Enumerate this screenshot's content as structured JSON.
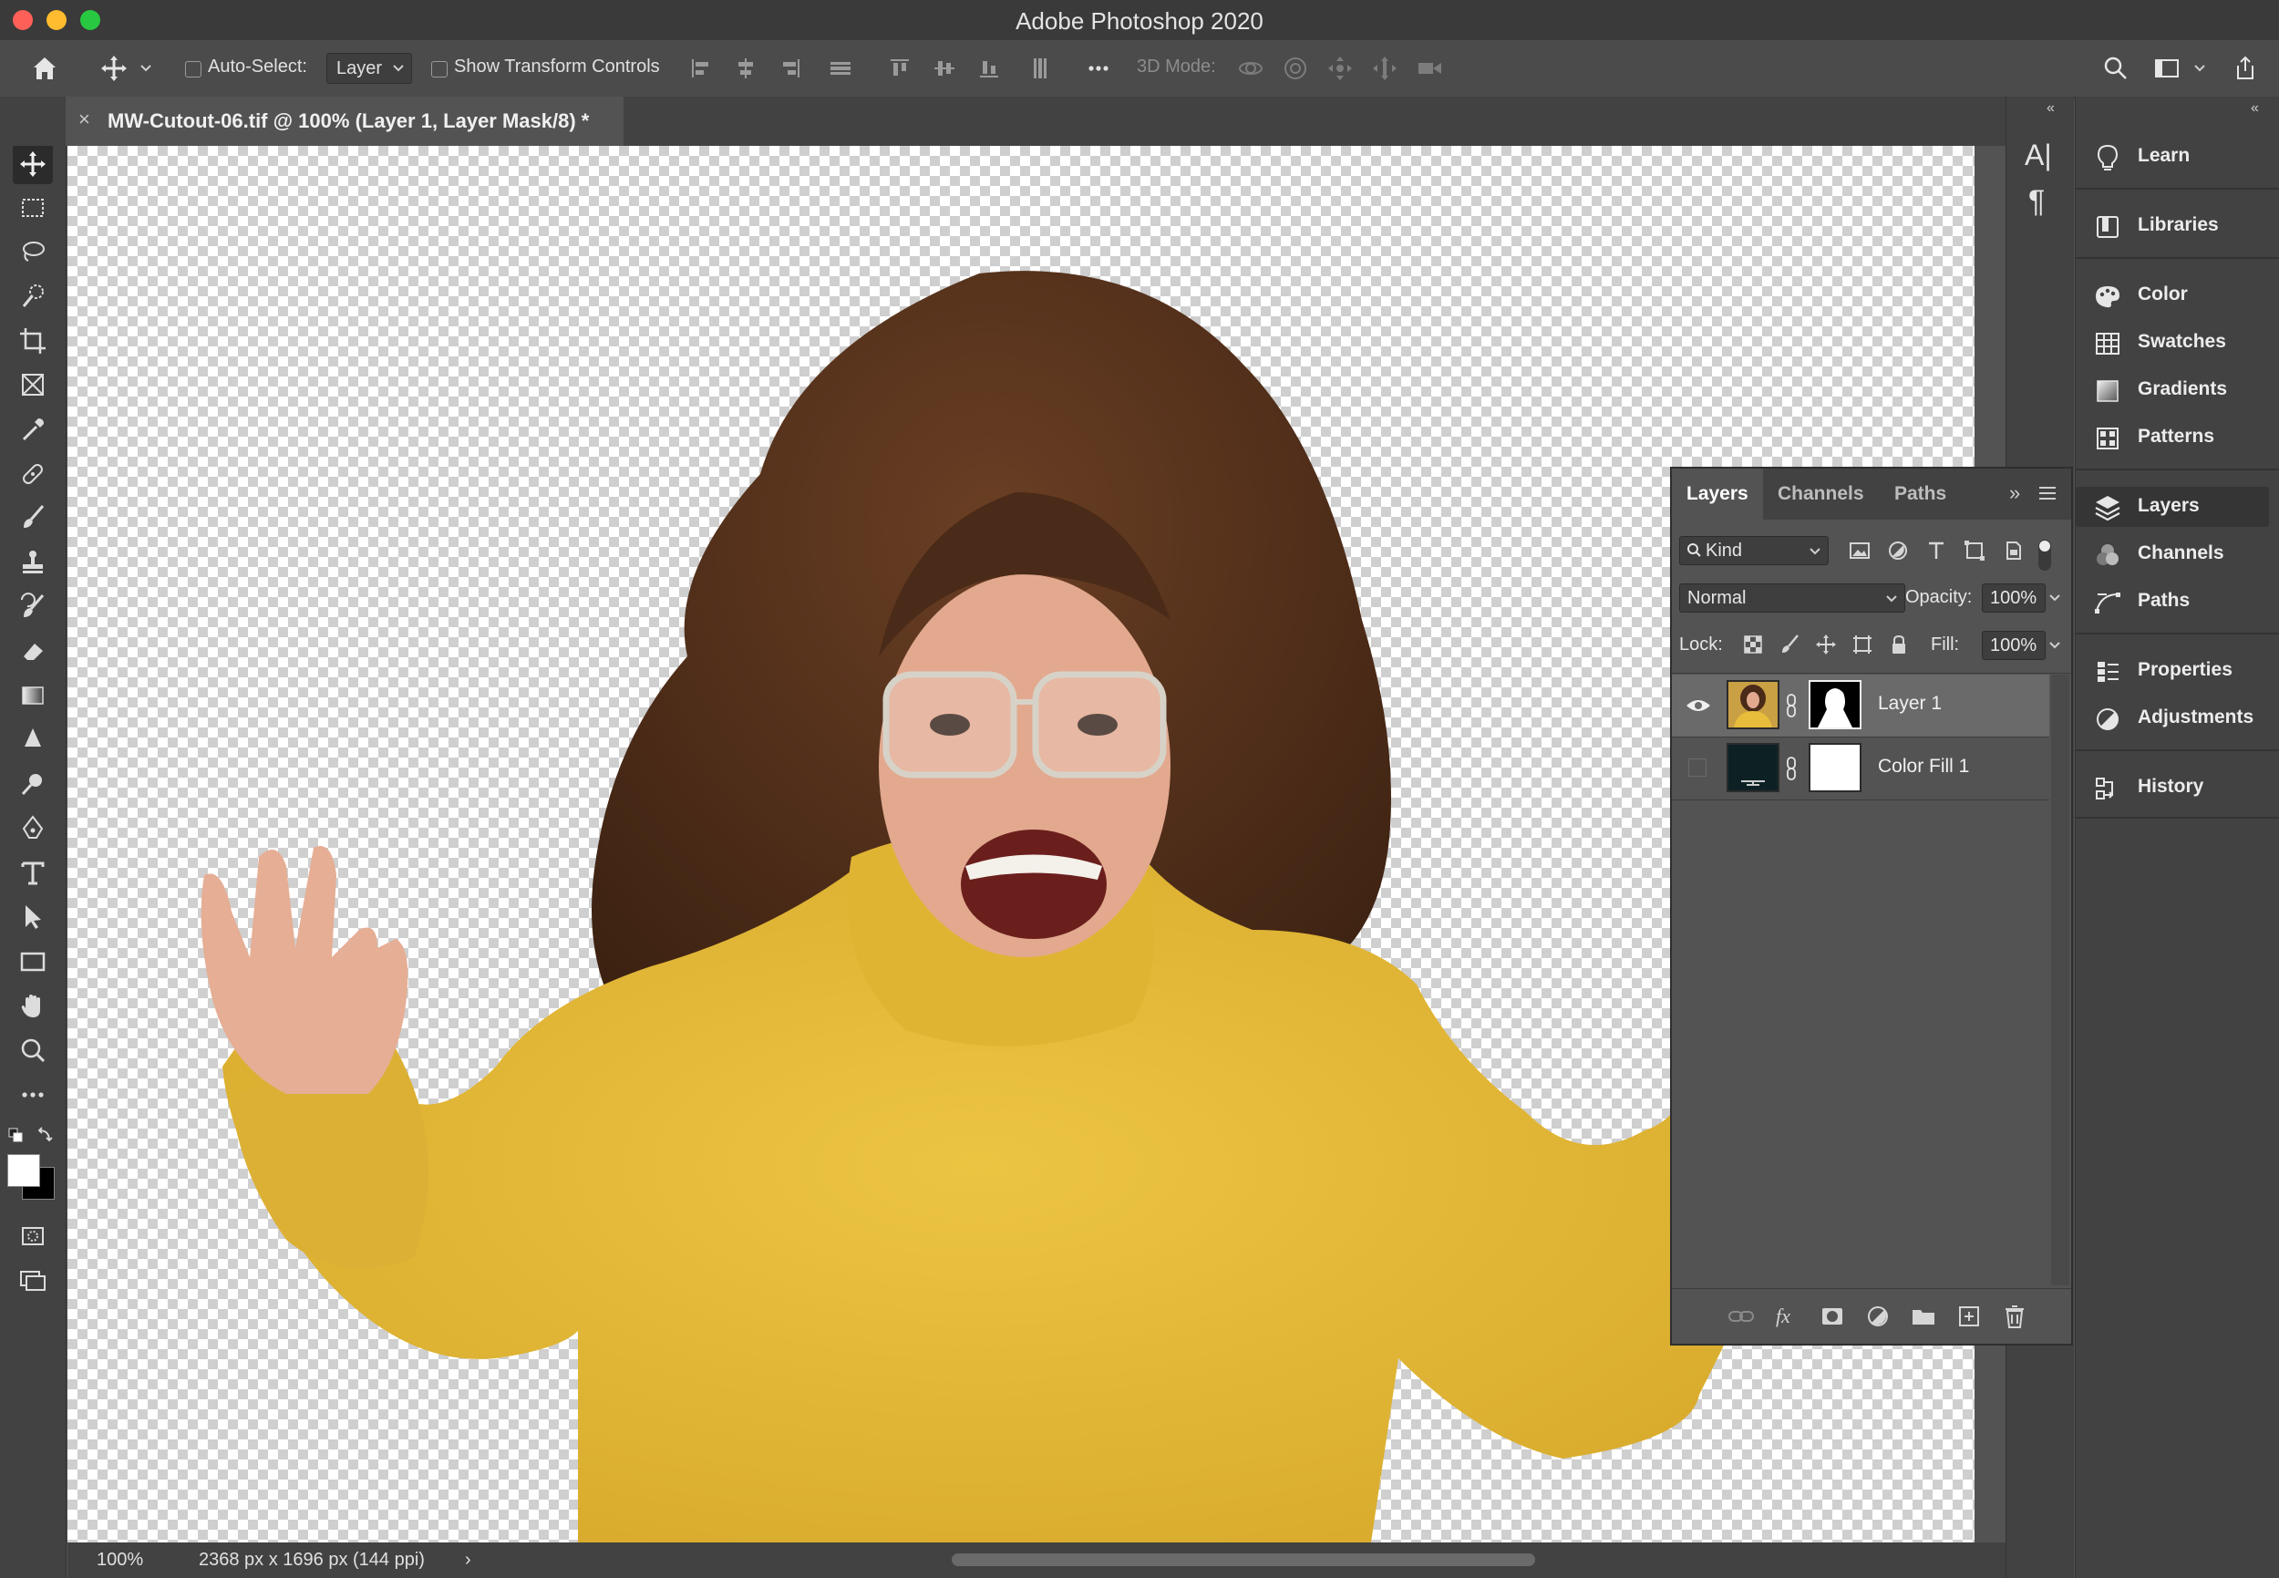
{
  "window": {
    "title": "Adobe Photoshop 2020"
  },
  "options_bar": {
    "auto_select_label": "Auto-Select:",
    "auto_select_target": "Layer",
    "show_transform_label": "Show Transform Controls",
    "mode_3d_label": "3D Mode:"
  },
  "document": {
    "tab_label": "MW-Cutout-06.tif @ 100% (Layer 1, Layer Mask/8) *",
    "close_glyph": "×"
  },
  "status": {
    "zoom": "100%",
    "dimensions": "2368 px x 1696 px (144 ppi)",
    "arrow": "›"
  },
  "narrow_column": {
    "character_glyph": "A|",
    "paragraph_glyph": "¶"
  },
  "dock": {
    "items": [
      {
        "label": "Learn",
        "icon": "lightbulb-icon"
      },
      {
        "label": "Libraries",
        "icon": "libraries-icon"
      },
      {
        "label": "Color",
        "icon": "palette-icon"
      },
      {
        "label": "Swatches",
        "icon": "grid-icon"
      },
      {
        "label": "Gradients",
        "icon": "gradient-icon"
      },
      {
        "label": "Patterns",
        "icon": "pattern-icon"
      },
      {
        "label": "Layers",
        "icon": "layers-icon"
      },
      {
        "label": "Channels",
        "icon": "channels-icon"
      },
      {
        "label": "Paths",
        "icon": "pen-path-icon"
      },
      {
        "label": "Properties",
        "icon": "properties-icon"
      },
      {
        "label": "Adjustments",
        "icon": "adjustments-icon"
      },
      {
        "label": "History",
        "icon": "history-icon"
      }
    ]
  },
  "layers_panel": {
    "tabs": [
      "Layers",
      "Channels",
      "Paths"
    ],
    "filter_kind": "Kind",
    "blend_mode": "Normal",
    "opacity_label": "Opacity:",
    "opacity_value": "100%",
    "lock_label": "Lock:",
    "fill_label": "Fill:",
    "fill_value": "100%",
    "layers": [
      {
        "name": "Layer 1",
        "visible": true,
        "selected": true
      },
      {
        "name": "Color Fill 1",
        "visible": false,
        "selected": false
      }
    ]
  },
  "colors": {
    "sweater": "#e6bd3a",
    "hair": "#4a2a18",
    "skin": "#e2a98f",
    "color_fill": "#0d2124",
    "ui_panel": "#535353",
    "ui_dark": "#424242"
  }
}
